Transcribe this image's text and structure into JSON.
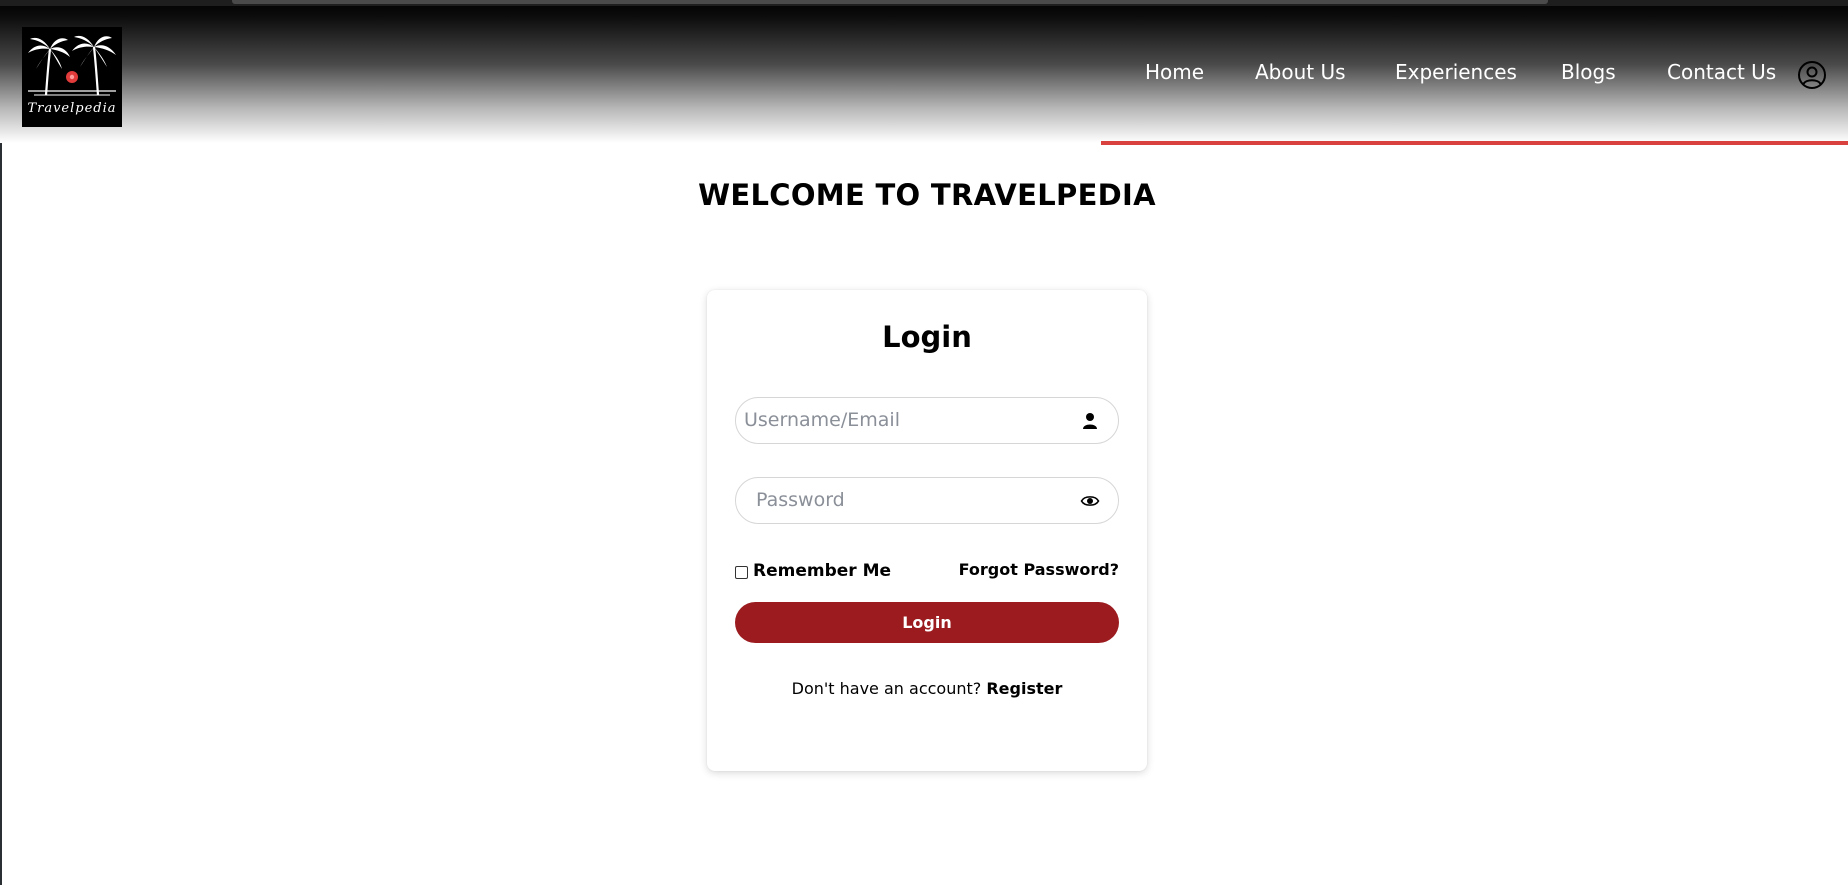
{
  "brand": {
    "name": "Travelpedia",
    "accent_color": "#9b1b1f",
    "underline_color": "#d9413e"
  },
  "nav": {
    "items": [
      {
        "label": "Home"
      },
      {
        "label": "About Us"
      },
      {
        "label": "Experiences"
      },
      {
        "label": "Blogs"
      },
      {
        "label": "Contact Us"
      }
    ],
    "account_icon": "user-circle-icon"
  },
  "page": {
    "welcome": "WELCOME TO TRAVELPEDIA"
  },
  "login_form": {
    "title": "Login",
    "username": {
      "placeholder": "Username/Email",
      "value": "",
      "icon": "person-icon"
    },
    "password": {
      "placeholder": "Password",
      "value": "",
      "icon": "eye-icon"
    },
    "remember_label": "Remember Me",
    "remember_checked": false,
    "forgot_label": "Forgot Password?",
    "submit_label": "Login",
    "register_prompt": "Don't have an account?",
    "register_label": "Register"
  }
}
